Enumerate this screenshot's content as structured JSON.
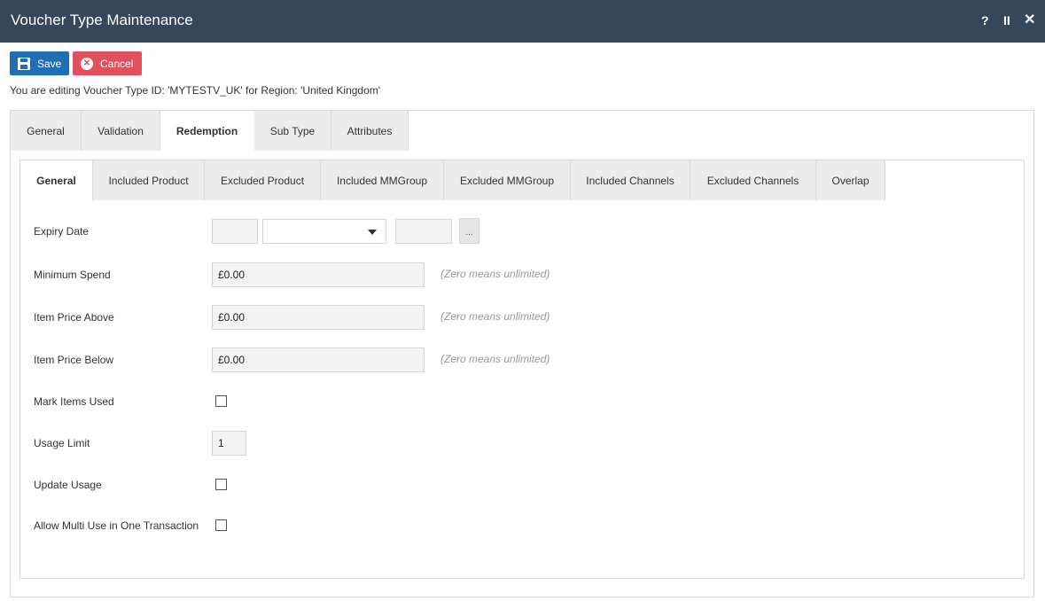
{
  "window": {
    "title": "Voucher Type Maintenance",
    "help": "?",
    "pause": "II",
    "close": "✕"
  },
  "toolbar": {
    "save_label": "Save",
    "cancel_label": "Cancel"
  },
  "edit_info": "You are editing Voucher Type ID: 'MYTESTV_UK' for Region: 'United Kingdom'",
  "main_tabs": [
    "General",
    "Validation",
    "Redemption",
    "Sub Type",
    "Attributes"
  ],
  "main_tab_active": "Redemption",
  "sub_tabs": [
    "General",
    "Included Product",
    "Excluded Product",
    "Included MMGroup",
    "Excluded MMGroup",
    "Included Channels",
    "Excluded Channels",
    "Overlap"
  ],
  "sub_tab_active": "General",
  "form": {
    "expiry_date": {
      "label": "Expiry Date",
      "value1": "",
      "select_value": "",
      "value2": "",
      "button": "..."
    },
    "minimum_spend": {
      "label": "Minimum Spend",
      "value": "£0.00",
      "hint": "(Zero means unlimited)"
    },
    "item_price_above": {
      "label": "Item Price Above",
      "value": "£0.00",
      "hint": "(Zero means unlimited)"
    },
    "item_price_below": {
      "label": "Item Price Below",
      "value": "£0.00",
      "hint": "(Zero means unlimited)"
    },
    "mark_items_used": {
      "label": "Mark Items Used",
      "checked": false
    },
    "usage_limit": {
      "label": "Usage Limit",
      "value": "1"
    },
    "update_usage": {
      "label": "Update Usage",
      "checked": false
    },
    "allow_multi_use": {
      "label": "Allow Multi Use in One Transaction",
      "checked": false
    }
  },
  "colors": {
    "titlebar": "#37475a",
    "save": "#1f6fb2",
    "cancel": "#e0505d"
  }
}
